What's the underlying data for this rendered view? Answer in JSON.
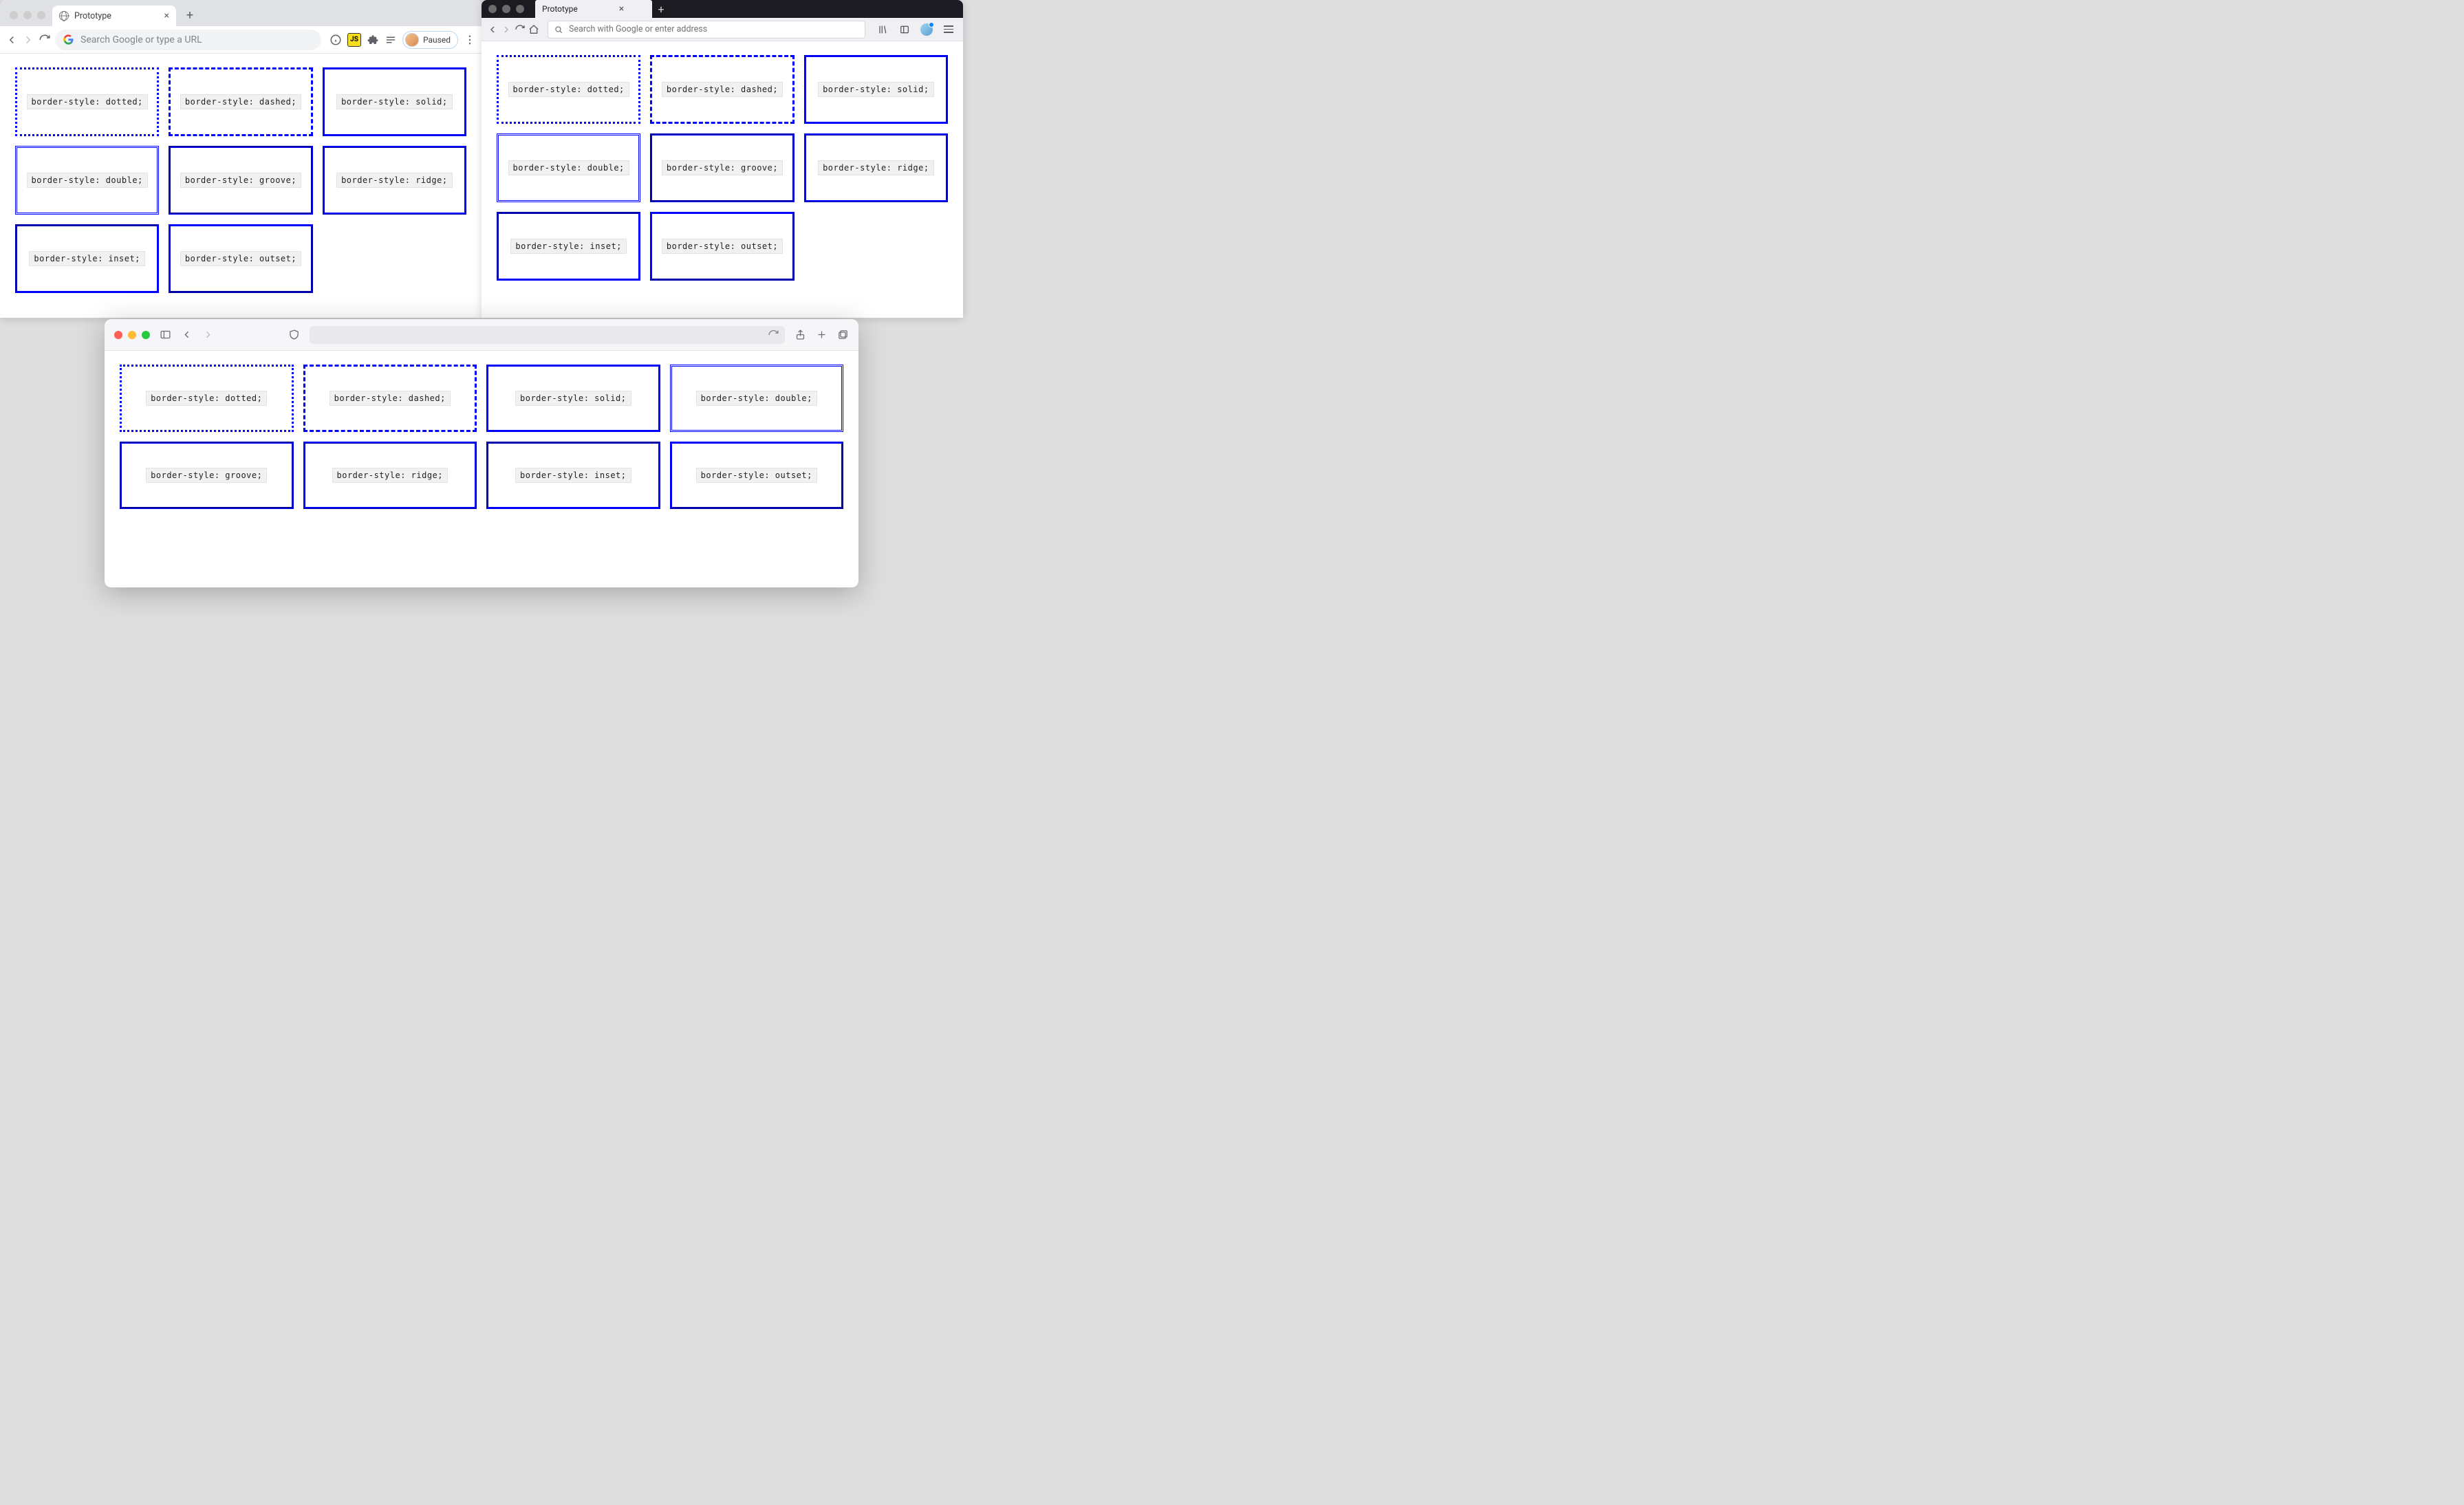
{
  "chrome": {
    "tab_title": "Prototype",
    "omnibox_placeholder": "Search Google or type a URL",
    "paused_label": "Paused"
  },
  "firefox": {
    "tab_title": "Prototype",
    "urlbar_placeholder": "Search with Google or enter address"
  },
  "border_styles": [
    {
      "class": "s-dotted",
      "label": "border-style: dotted;"
    },
    {
      "class": "s-dashed",
      "label": "border-style: dashed;"
    },
    {
      "class": "s-solid",
      "label": "border-style: solid;"
    },
    {
      "class": "s-double",
      "label": "border-style: double;"
    },
    {
      "class": "s-groove",
      "label": "border-style: groove;"
    },
    {
      "class": "s-ridge",
      "label": "border-style: ridge;"
    },
    {
      "class": "s-inset",
      "label": "border-style: inset;"
    },
    {
      "class": "s-outset",
      "label": "border-style: outset;"
    }
  ],
  "colors": {
    "border_color": "blue"
  }
}
